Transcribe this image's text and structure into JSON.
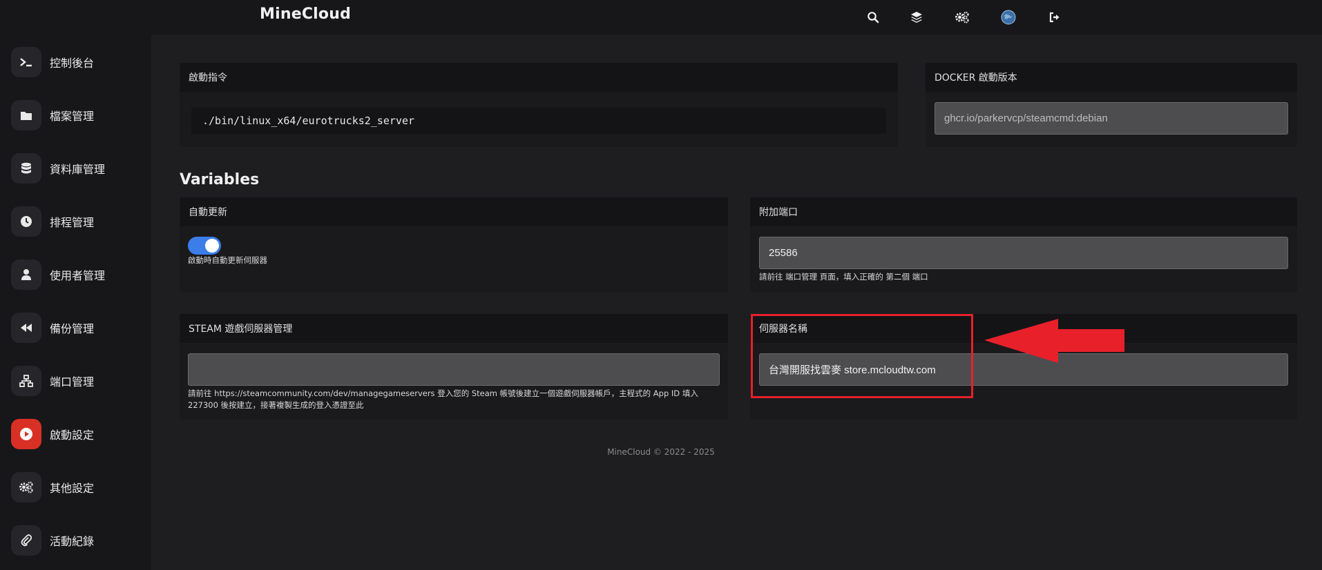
{
  "header": {
    "brand": "MineCloud",
    "icons": [
      "search-icon",
      "layers-icon",
      "gears-icon",
      "globe-avatar-icon",
      "logout-icon"
    ]
  },
  "sidebar": {
    "items": [
      {
        "label": "控制後台",
        "icon": "terminal-icon"
      },
      {
        "label": "檔案管理",
        "icon": "folder-icon"
      },
      {
        "label": "資料庫管理",
        "icon": "database-icon"
      },
      {
        "label": "排程管理",
        "icon": "clock-icon"
      },
      {
        "label": "使用者管理",
        "icon": "user-icon"
      },
      {
        "label": "備份管理",
        "icon": "backward-icon"
      },
      {
        "label": "端口管理",
        "icon": "network-icon"
      },
      {
        "label": "啟動設定",
        "icon": "play-icon",
        "active": true
      },
      {
        "label": "其他設定",
        "icon": "gears-icon"
      },
      {
        "label": "活動紀錄",
        "icon": "paperclip-icon"
      }
    ]
  },
  "startup": {
    "command_title": "啟動指令",
    "command_value": "./bin/linux_x64/eurotrucks2_server",
    "docker_title": "DOCKER 啟動版本",
    "docker_value": "ghcr.io/parkervcp/steamcmd:debian"
  },
  "variables": {
    "section_title": "Variables",
    "auto_update": {
      "title": "自動更新",
      "enabled": true,
      "help": "啟動時自動更新伺服器"
    },
    "extra_port": {
      "title": "附加端口",
      "value": "25586",
      "help": "請前往 端口管理 頁面，填入正確的 第二個 端口"
    },
    "steam_gsm": {
      "title": "STEAM 遊戲伺服器管理",
      "value": "",
      "help_line1": "請前往 https://steamcommunity.com/dev/managegameservers 登入您的 Steam 帳號後建立一個遊戲伺服器帳戶，主程式的 App ID 填入",
      "help_line2": "227300 後按建立，接著複製生成的登入憑證至此"
    },
    "server_name": {
      "title": "伺服器名稱",
      "value": "台灣開服找雲麥 store.mcloudtw.com"
    }
  },
  "footer": {
    "text": "MineCloud © 2022 - 2025"
  },
  "colors": {
    "accent": "#3b7de9",
    "active_nav": "#d93025",
    "highlight": "#e8202a"
  }
}
